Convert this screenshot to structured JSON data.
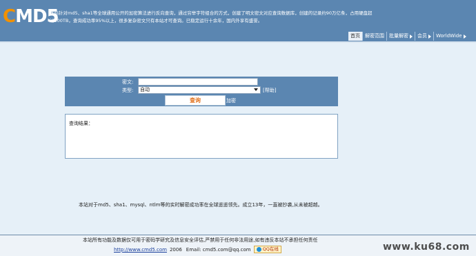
{
  "header": {
    "logo_c": "C",
    "logo_rest": "MD5",
    "intro_line1": "本站针对md5、sha1等全球通用公开的加密算法进行反向查询，通过穷举字符组合的方式，创建了明文密文对应查询数据库，创建的记录约90万亿条，占用硬盘超",
    "intro_line2": "过500TB，查询成功率95%以上，很多复杂密文只有本站才可查询。已稳定运行十余年，国内外享有盛誉。",
    "nav": [
      {
        "label": "首页",
        "has_arrow": false
      },
      {
        "label": "解密范围",
        "has_arrow": false
      },
      {
        "label": "批量解密",
        "has_arrow": true
      },
      {
        "label": "会员",
        "has_arrow": true
      },
      {
        "label": "WorldWide",
        "has_arrow": true
      }
    ]
  },
  "search": {
    "cipher_label": "密文:",
    "cipher_value": "",
    "type_label": "类型:",
    "type_value": "自动",
    "help_label": "[帮助]",
    "query_button": "查询",
    "encrypt_link": "加密"
  },
  "result": {
    "label": "查询结果："
  },
  "tagline": "本站对于md5、sha1、mysql、ntlm等的实时解密成功率在全球遥遥领先。成立13年，一直被抄袭,从未被超越。",
  "footer": {
    "disclaimer": "本站所有功能及数据仅可用于密码学研究及信息安全评估,严禁用于任何非法用途,如有违反本站不承担任何责任",
    "site_url": "http://www.cmd5.com",
    "year": "2006",
    "email_label": "Email: cmd5.com@qq.com",
    "qq_label": "QQ在线"
  },
  "watermark": "www.ku68.com",
  "colors": {
    "header_bg": "#5b86b1",
    "page_bg": "#e6f0f8",
    "logo_accent": "#f29100",
    "query_text": "#e0711c"
  }
}
